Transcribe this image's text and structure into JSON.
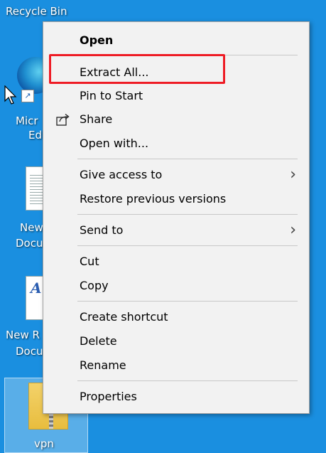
{
  "desktop": {
    "recycle_bin_label": "Recycle Bin",
    "edge_label_line1": "Micr",
    "edge_label_line2": "Ed",
    "doc1_label_line1": "New",
    "doc1_label_line2": "Docu",
    "doc2_label_line1": "New R",
    "doc2_label_line2": "Docu",
    "zip_label": "vpn"
  },
  "menu": {
    "open": "Open",
    "extract_all": "Extract All...",
    "pin_to_start": "Pin to Start",
    "share": "Share",
    "open_with": "Open with...",
    "give_access_to": "Give access to",
    "restore_previous_versions": "Restore previous versions",
    "send_to": "Send to",
    "cut": "Cut",
    "copy": "Copy",
    "create_shortcut": "Create shortcut",
    "delete": "Delete",
    "rename": "Rename",
    "properties": "Properties"
  },
  "colors": {
    "desktop_bg": "#1a8fe0",
    "menu_bg": "#f2f2f2",
    "highlight": "#ee1c25"
  }
}
